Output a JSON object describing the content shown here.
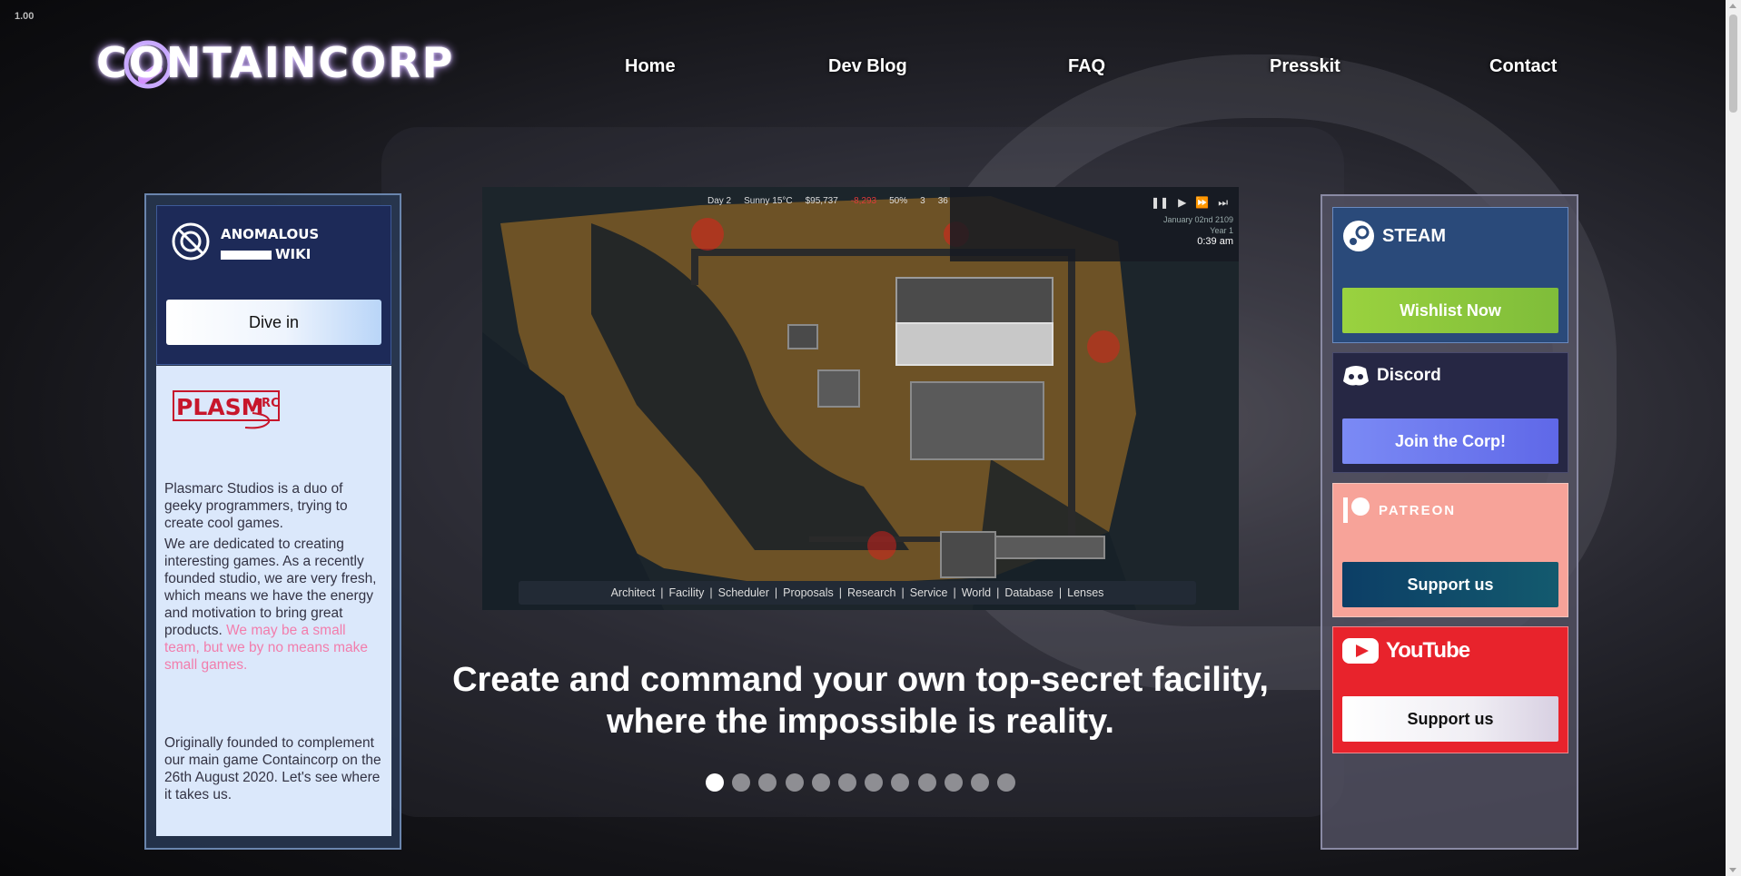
{
  "zoom_label": "1.00",
  "header": {
    "logo_text": "CONTAINCORP",
    "nav": [
      "Home",
      "Dev Blog",
      "FAQ",
      "Presskit",
      "Contact"
    ]
  },
  "left": {
    "wiki_title_line1": "ANOMALOUS",
    "wiki_title_line2": "WIKI",
    "dive_button": "Dive in",
    "studio_logo_text": "PLASMARC",
    "about_p1": "Plasmarc Studios is a duo of geeky programmers, trying to create cool games.",
    "about_p2_start": "We are dedicated to creating interesting games. As a recently founded studio, we are very fresh, which means we have the energy and motivation to bring great products.",
    "about_p2_highlight": "We may be a small team, but we by no means make small games.",
    "about_p3": "Originally founded to complement our main game Containcorp on the 26th August 2020. Let's see where it takes us."
  },
  "game": {
    "hud_day": "Day 2",
    "hud_weather": "Sunny 15°C",
    "hud_money": "$95,737",
    "hud_change": "-8,293",
    "hud_percent": "50%",
    "hud_staff": "3",
    "hud_people": "36",
    "hud_date": "January 02nd 2109",
    "hud_year": "Year 1",
    "hud_time": "0:39 am",
    "toolbar": [
      "Architect",
      "Facility",
      "Scheduler",
      "Proposals",
      "Research",
      "Service",
      "World",
      "Database",
      "Lenses"
    ]
  },
  "tagline_line1": "Create and command your own top-secret facility,",
  "tagline_line2": "where the impossible is reality.",
  "carousel": {
    "count": 12,
    "active": 0
  },
  "right": {
    "steam": {
      "title": "STEAM",
      "button": "Wishlist Now",
      "bg": "#2a4a7a",
      "button_bg": "#8dc63f"
    },
    "discord": {
      "title": "Discord",
      "button": "Join the Corp!",
      "bg": "#262744",
      "button_bg": "#6574f0"
    },
    "patreon": {
      "title": "PATREON",
      "button": "Support us",
      "bg": "#f7a399",
      "button_bg": "#0e4a6a"
    },
    "youtube": {
      "title": "YouTube",
      "button": "Support us",
      "bg": "#e8232c",
      "button_bg": "#f3f1f5"
    }
  }
}
